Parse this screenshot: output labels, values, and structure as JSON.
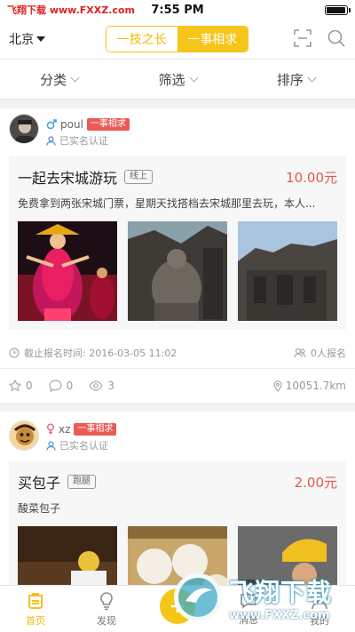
{
  "status_bar": {
    "watermark": "飞翔下载 www.FXXZ.com",
    "time": "7:55 PM",
    "battery_level": 0.95
  },
  "nav": {
    "city": "北京",
    "segments": [
      "一技之长",
      "一事相求"
    ],
    "active_segment": 1,
    "icons": [
      "scan-icon",
      "search-icon"
    ]
  },
  "filters": [
    "分类",
    "筛选",
    "排序"
  ],
  "posts": [
    {
      "username": "poul",
      "gender": "male",
      "tag": "一事相求",
      "verified": "已实名认证",
      "title": "一起去宋城游玩",
      "type_tag": "线上",
      "price": "10.00元",
      "description": "免费拿到两张宋城门票，星期天找搭档去宋城那里去玩，本人...",
      "deadline": "截止报名时间: 2016-03-05 11:02",
      "signups": "0人报名",
      "likes": "0",
      "comments": "0",
      "views": "3",
      "distance": "10051.7km"
    },
    {
      "username": "xz",
      "gender": "female",
      "tag": "一事相求",
      "verified": "已实名认证",
      "title": "买包子",
      "type_tag": "跑腿",
      "price": "2.00元",
      "description": "酸菜包子"
    }
  ],
  "tabbar": {
    "items": [
      "首页",
      "发现",
      "",
      "消息",
      "我的"
    ],
    "active": 0
  },
  "watermark_bottom": {
    "main": "飞翔下载",
    "sub": "www.FXXZ.com"
  },
  "colors": {
    "accent": "#f5c518",
    "price": "#e2584e",
    "badge": "#ea5a56"
  }
}
